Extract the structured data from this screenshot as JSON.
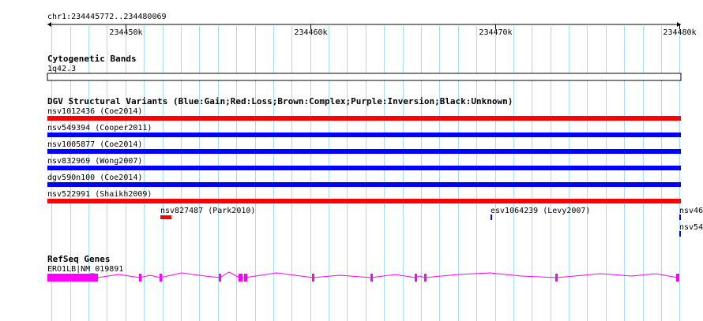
{
  "locus": "chr1:234445772..234480069",
  "ruler": {
    "start": 234445772,
    "end": 234480069,
    "ticks": [
      {
        "pos": 234450000,
        "label": "234450k"
      },
      {
        "pos": 234460000,
        "label": "234460k"
      },
      {
        "pos": 234470000,
        "label": "234470k"
      },
      {
        "pos": 234480000,
        "label": "234480k"
      }
    ],
    "minor_step": 1000
  },
  "cytoband": {
    "title": "Cytogenetic Bands",
    "band": "1q42.3"
  },
  "dgv": {
    "title": "DGV Structural Variants (Blue:Gain;Red:Loss;Brown:Complex;Purple:Inversion;Black:Unknown)",
    "colors": {
      "gain": "#0000ff",
      "loss": "#ff0000"
    },
    "full_variants": [
      {
        "label": "nsv1012436 (Coe2014)",
        "type": "loss"
      },
      {
        "label": "nsv549394 (Cooper2011)",
        "type": "gain"
      },
      {
        "label": "nsv1005877 (Coe2014)",
        "type": "gain"
      },
      {
        "label": "nsv832969 (Wong2007)",
        "type": "gain"
      },
      {
        "label": "dgv590n100 (Coe2014)",
        "type": "gain"
      },
      {
        "label": "nsv522991 (Shaikh2009)",
        "type": "loss"
      }
    ],
    "small_variants": [
      {
        "label": "nsv827487 (Park2010)",
        "type": "loss"
      },
      {
        "label": "esv1064239 (Levy2007)",
        "type": "gain"
      },
      {
        "label": "nsv46",
        "type": "gain"
      },
      {
        "label": "nsv54",
        "type": "gain"
      }
    ]
  },
  "genes": {
    "title": "RefSeq Genes",
    "gene_label": "ERO1LB|NM_019891",
    "color": "#ff00ff"
  }
}
